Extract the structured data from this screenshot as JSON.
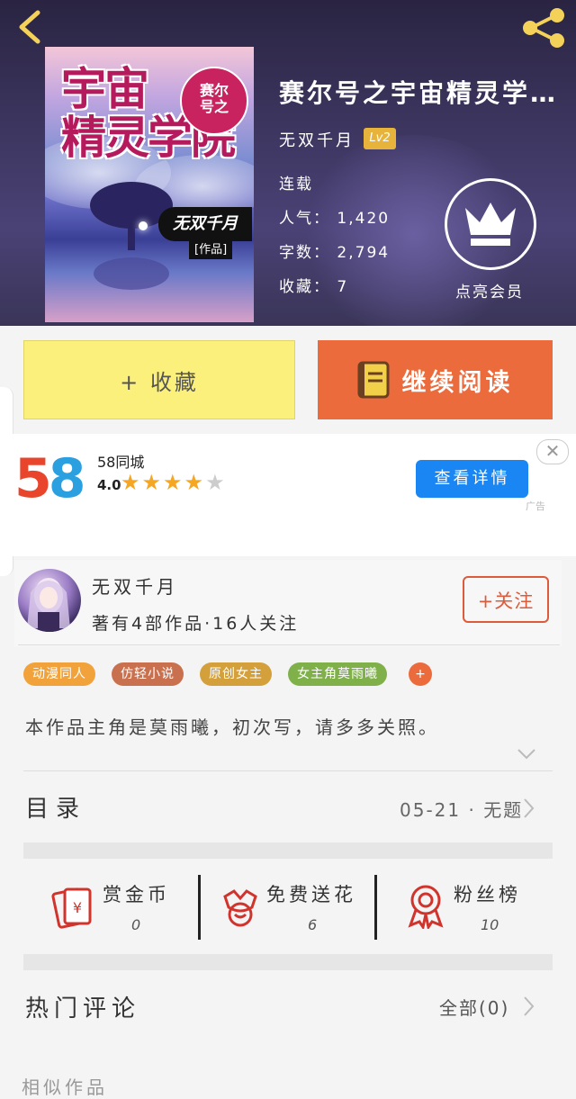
{
  "book": {
    "cover_title": "宇宙\n精灵学院",
    "cover_badge": "赛尔\n号之",
    "cover_author": "无双千月",
    "cover_works": "[作品]",
    "title": "赛尔号之宇宙精灵学…",
    "author": "无双千月",
    "level": "Lv2",
    "status": "连载",
    "popularity": "人气： 1,420",
    "word_count": "字数： 2,794",
    "favorites": "收藏： 7",
    "vip_label": "点亮会员"
  },
  "actions": {
    "collect": "+ 收藏",
    "read": "继续阅读"
  },
  "ad": {
    "name": "58同城",
    "score": "4.0",
    "stars": "★★★★",
    "star_empty": "★",
    "button": "查看详情",
    "close": "✕",
    "tag": "广告",
    "logo_5": "5",
    "logo_8": "8"
  },
  "author_card": {
    "name": "无双千月",
    "meta": "著有4部作品·16人关注",
    "follow": "+关注"
  },
  "tags": [
    "动漫同人",
    "仿轻小说",
    "原创女主",
    "女主角莫雨曦",
    "+"
  ],
  "synopsis": "本作品主角是莫雨曦，初次写，请多多关照。",
  "toc": {
    "title": "目录",
    "latest": "05-21 · 无题"
  },
  "stats": [
    {
      "label": "赏金币",
      "value": "0"
    },
    {
      "label": "免费送花",
      "value": "6"
    },
    {
      "label": "粉丝榜",
      "value": "10"
    }
  ],
  "comments": {
    "title": "热门评论",
    "all": "全部(0)"
  },
  "similar_title": "相似作品",
  "colors": {
    "accent": "#ec6b3d",
    "collect_bg": "#fbf07c",
    "tag_colors": [
      "#f2a23a",
      "#c9714f",
      "#d4a03c",
      "#7fb04a",
      "#ec6b3d"
    ]
  }
}
